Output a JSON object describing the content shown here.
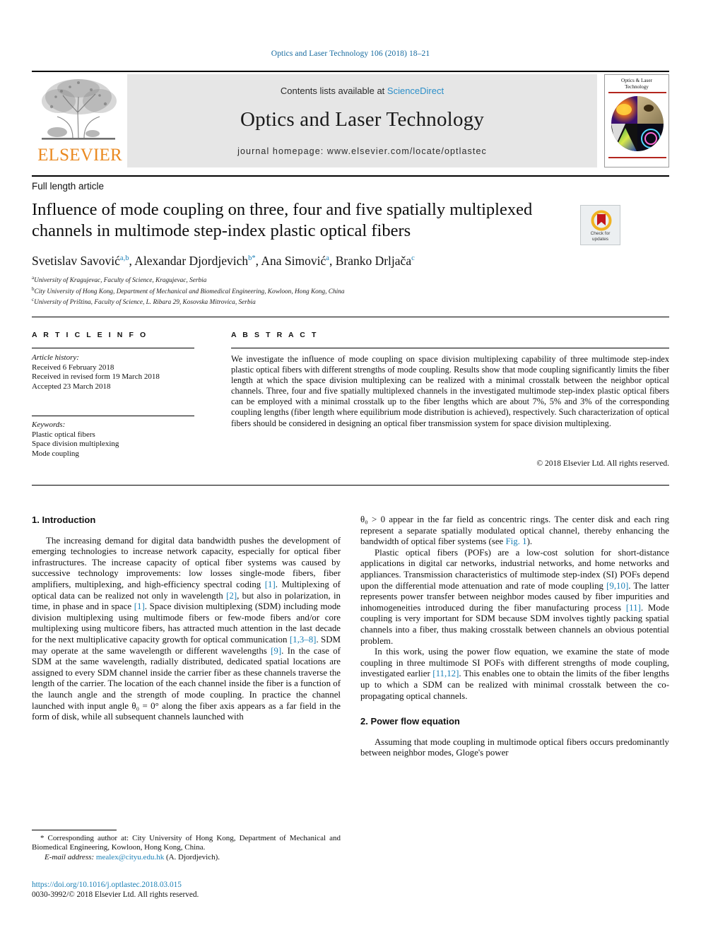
{
  "running_head": "Optics and Laser Technology 106 (2018) 18–21",
  "masthead": {
    "contents_prefix": "Contents lists available at ",
    "sciencedirect": "ScienceDirect",
    "journal_title": "Optics and Laser Technology",
    "homepage": "journal homepage: www.elsevier.com/locate/optlastec",
    "publisher": "ELSEVIER",
    "cover_title_line1": "Optics & Laser",
    "cover_title_line2": "Technology",
    "accent_orange": "#ea8a22",
    "accent_blue": "#1a7fb5",
    "cover_rule_color": "#b3261e"
  },
  "article": {
    "type": "Full length article",
    "title": "Influence of mode coupling on three, four and five spatially multiplexed channels in multimode step-index plastic optical fibers",
    "crossmark": {
      "line1": "Check for",
      "line2": "updates"
    },
    "authors": [
      {
        "name": "Svetislav Savović",
        "sup": "a,b"
      },
      {
        "name": "Alexandar Djordjevich",
        "sup": "b",
        "star": "*"
      },
      {
        "name": "Ana Simović",
        "sup": "a"
      },
      {
        "name": "Branko Drljača",
        "sup": "c"
      }
    ],
    "affiliations": [
      {
        "marker": "a",
        "text": "University of Kragujevac, Faculty of Science, Kragujevac, Serbia"
      },
      {
        "marker": "b",
        "text": "City University of Hong Kong, Department of Mechanical and Biomedical Engineering, Kowloon, Hong Kong, China"
      },
      {
        "marker": "c",
        "text": "University of Priština, Faculty of Science, L. Ribara 29, Kosovska Mitrovica, Serbia"
      }
    ]
  },
  "info": {
    "heading": "A R T I C L E   I N F O",
    "history_label": "Article history:",
    "history": [
      "Received 6 February 2018",
      "Received in revised form 19 March 2018",
      "Accepted 23 March 2018"
    ],
    "keywords_label": "Keywords:",
    "keywords": [
      "Plastic optical fibers",
      "Space division multiplexing",
      "Mode coupling"
    ]
  },
  "abstract": {
    "heading": "A B S T R A C T",
    "text": "We investigate the influence of mode coupling on space division multiplexing capability of three multimode step-index plastic optical fibers with different strengths of mode coupling. Results show that mode coupling significantly limits the fiber length at which the space division multiplexing can be realized with a minimal crosstalk between the neighbor optical channels. Three, four and five spatially multiplexed channels in the investigated multimode step-index plastic optical fibers can be employed with a minimal crosstalk up to the fiber lengths which are about 7%, 5% and 3% of the corresponding coupling lengths (fiber length where equilibrium mode distribution is achieved), respectively. Such characterization of optical fibers should be considered in designing an optical fiber transmission system for space division multiplexing.",
    "copyright": "© 2018 Elsevier Ltd. All rights reserved."
  },
  "sections": {
    "introduction_heading": "1. Introduction",
    "intro_p1_a": "The increasing demand for digital data bandwidth pushes the development of emerging technologies to increase network capacity, especially for optical fiber infrastructures. The increase capacity of optical fiber systems was caused by successive technology improvements: low losses single-mode fibers, fiber amplifiers, multiplexing, and high-efficiency spectral coding ",
    "intro_ref1": "[1]",
    "intro_p1_b": ". Multiplexing of optical data can be realized not only in wavelength ",
    "intro_ref2": "[2]",
    "intro_p1_c": ", but also in polarization, in time, in phase and in space ",
    "intro_ref3": "[1]",
    "intro_p1_d": ". Space division multiplexing (SDM) including mode division multiplexing using multimode fibers or few-mode fibers and/or core multiplexing using multicore fibers, has attracted much attention in the last decade for the next multiplicative capacity growth for optical communication ",
    "intro_ref4": "[1,3–8]",
    "intro_p1_e": ". SDM may operate at the same wavelength or different wavelengths ",
    "intro_ref5": "[9]",
    "intro_p1_f": ". In the case of SDM at the same wavelength, radially distributed, dedicated spatial locations are assigned to every SDM channel inside the carrier fiber as these channels traverse the length of the carrier. The location of the each channel inside the fiber is a function of the launch angle and the strength of mode coupling. In practice the channel launched with input angle ",
    "intro_theta_inline": "θ₀ = 0°",
    "intro_p1_g": " along the fiber axis appears as a far field in the form of disk, while all subsequent channels launched with",
    "intro_p2_a": "θ₀ > 0",
    "intro_p2_b": " appear in the far field as concentric rings. The center disk and each ring represent a separate spatially modulated optical channel, thereby enhancing the bandwidth of optical fiber systems (see ",
    "intro_fig1": "Fig. 1",
    "intro_p2_c": ").",
    "intro_p3_a": "Plastic optical fibers (POFs) are a low-cost solution for short-distance applications in digital car networks, industrial networks, and home networks and appliances. Transmission characteristics of multimode step-index (SI) POFs depend upon the differential mode attenuation and rate of mode coupling ",
    "intro_ref6": "[9,10]",
    "intro_p3_b": ". The latter represents power transfer between neighbor modes caused by fiber impurities and inhomogeneities introduced during the fiber manufacturing process ",
    "intro_ref7": "[11]",
    "intro_p3_c": ". Mode coupling is very important for SDM because SDM involves tightly packing spatial channels into a fiber, thus making crosstalk between channels an obvious potential problem.",
    "intro_p4_a": "In this work, using the power flow equation, we examine the state of mode coupling in three multimode SI POFs with different strengths of mode coupling, investigated earlier ",
    "intro_ref8": "[11,12]",
    "intro_p4_b": ". This enables one to obtain the limits of the fiber lengths up to which a SDM can be realized with minimal crosstalk between the co-propagating optical channels.",
    "power_flow_heading": "2. Power flow equation",
    "power_flow_p1": "Assuming that mode coupling in multimode optical fibers occurs predominantly between neighbor modes, Gloge's power"
  },
  "footnote": {
    "star": "*",
    "corresponding": " Corresponding author at: City University of Hong Kong, Department of Mechanical and Biomedical Engineering, Kowloon, Hong Kong, China.",
    "email_label": "E-mail address:",
    "email": "mealex@cityu.edu.hk",
    "email_owner": "(A. Djordjevich).",
    "doi": "https://doi.org/10.1016/j.optlastec.2018.03.015",
    "issn_line": "0030-3992/© 2018 Elsevier Ltd. All rights reserved."
  }
}
